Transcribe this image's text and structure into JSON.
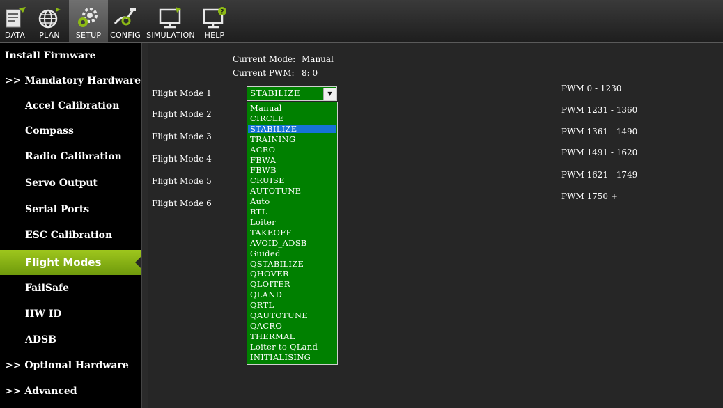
{
  "toolbar": {
    "items": [
      {
        "label": "DATA",
        "icon": "data-icon"
      },
      {
        "label": "PLAN",
        "icon": "plan-icon"
      },
      {
        "label": "SETUP",
        "icon": "setup-icon",
        "active": true
      },
      {
        "label": "CONFIG",
        "icon": "config-icon"
      },
      {
        "label": "SIMULATION",
        "icon": "simulation-icon"
      },
      {
        "label": "HELP",
        "icon": "help-icon"
      }
    ]
  },
  "sidebar": {
    "items": [
      {
        "label": "Install Firmware",
        "level": "top"
      },
      {
        "label": ">> Mandatory Hardware",
        "level": "top"
      },
      {
        "label": "Accel Calibration",
        "level": "sub"
      },
      {
        "label": "Compass",
        "level": "sub"
      },
      {
        "label": "Radio Calibration",
        "level": "sub"
      },
      {
        "label": "Servo Output",
        "level": "sub"
      },
      {
        "label": "Serial Ports",
        "level": "sub"
      },
      {
        "label": "ESC Calibration",
        "level": "sub"
      },
      {
        "label": "Flight Modes",
        "level": "sub",
        "selected": true
      },
      {
        "label": "FailSafe",
        "level": "sub"
      },
      {
        "label": "HW ID",
        "level": "sub"
      },
      {
        "label": "ADSB",
        "level": "sub"
      },
      {
        "label": ">> Optional Hardware",
        "level": "top"
      },
      {
        "label": ">> Advanced",
        "level": "top"
      }
    ]
  },
  "status": {
    "current_mode_label": "Current Mode:",
    "current_mode_value": "Manual",
    "current_pwm_label": "Current PWM:",
    "current_pwm_value": "8: 0"
  },
  "flight_modes": [
    {
      "label": "Flight Mode 1",
      "pwm": "PWM 0 - 1230"
    },
    {
      "label": "Flight Mode 2",
      "pwm": "PWM 1231 - 1360"
    },
    {
      "label": "Flight Mode 3",
      "pwm": "PWM 1361 - 1490"
    },
    {
      "label": "Flight Mode 4",
      "pwm": "PWM 1491 - 1620"
    },
    {
      "label": "Flight Mode 5",
      "pwm": "PWM 1621 - 1749"
    },
    {
      "label": "Flight Mode 6",
      "pwm": "PWM 1750 +"
    }
  ],
  "combo": {
    "selected": "STABILIZE",
    "arrow_icon": "chevron-down-icon"
  },
  "dropdown": {
    "highlighted": "STABILIZE",
    "options": [
      "Manual",
      "CIRCLE",
      "STABILIZE",
      "TRAINING",
      "ACRO",
      "FBWA",
      "FBWB",
      "CRUISE",
      "AUTOTUNE",
      "Auto",
      "RTL",
      "Loiter",
      "TAKEOFF",
      "AVOID_ADSB",
      "Guided",
      "QSTABILIZE",
      "QHOVER",
      "QLOITER",
      "QLAND",
      "QRTL",
      "QAUTOTUNE",
      "QACRO",
      "THERMAL",
      "Loiter to QLand",
      "INITIALISING"
    ]
  },
  "colors": {
    "accent_green": "#8dba15",
    "combo_green": "#008000",
    "highlight_blue": "#1673d6",
    "background": "#262626"
  }
}
